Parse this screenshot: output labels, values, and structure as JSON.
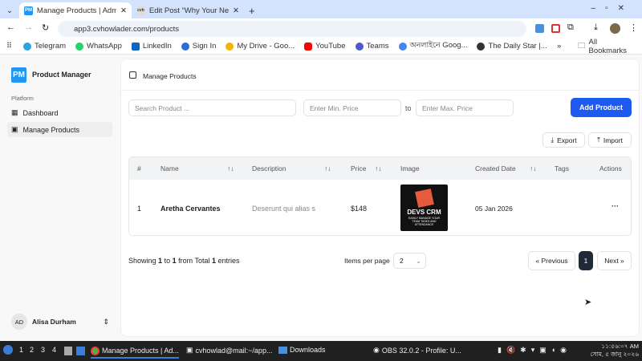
{
  "browser": {
    "tabs": [
      {
        "title": "Manage Products | Admin",
        "favicon": "PM"
      },
      {
        "title": "Edit Post “Why Your Next",
        "favicon": "cvh"
      }
    ],
    "url": "app3.cvhowlader.com/products",
    "bookmarks": [
      "Telegram",
      "WhatsApp",
      "LinkedIn",
      "Sign In",
      "My Drive - Goo...",
      "YouTube",
      "Teams",
      "অনলাইনে Goog...",
      "The Daily Star |..."
    ],
    "all_bookmarks": "All Bookmarks",
    "bookmark_colors": [
      "#2aa3e0",
      "#25d366",
      "#0a66c2",
      "#2b6cd8",
      "#f4b400",
      "#ff0000",
      "#5059c9",
      "#4285f4",
      "#333333"
    ]
  },
  "sidebar": {
    "logo": "PM",
    "app_name": "Product Manager",
    "section": "Platform",
    "items": [
      {
        "label": "Dashboard"
      },
      {
        "label": "Manage Products"
      }
    ],
    "user": {
      "initials": "AD",
      "name": "Alisa Durham"
    }
  },
  "main": {
    "breadcrumb": "Manage Products",
    "search_placeholder": "Search Product ...",
    "min_placeholder": "Enter Min. Price",
    "to": "to",
    "max_placeholder": "Enter Max. Price",
    "add_button": "Add Product",
    "export": "Export",
    "import": "Import",
    "columns": [
      "#",
      "Name",
      "Description",
      "Price",
      "Image",
      "Created Date",
      "Tags",
      "Actions"
    ],
    "rows": [
      {
        "num": "1",
        "name": "Aretha Cervantes",
        "description": "Deserunt qui alias s",
        "price": "$148",
        "image_title": "DEVS CRM",
        "image_sub": "EASILY MANAGE YOUR TEAM TASKS AND ATTENDANCE",
        "date": "05 Jan 2026",
        "tags": "",
        "actions": "···"
      }
    ],
    "showing": {
      "prefix": "Showing",
      "from": "1",
      "to_word": "to",
      "to": "1",
      "mid": "from Total",
      "total": "1",
      "suffix": "entries"
    },
    "items_per_page_label": "Items per page",
    "items_per_page": "2",
    "prev": "« Previous",
    "page": "1",
    "next": "Next »"
  },
  "taskbar": {
    "workspaces": [
      "1",
      "2",
      "3",
      "4"
    ],
    "apps": [
      "Manage Products | Ad...",
      "cvhowlad@mail:~/app...",
      "Downloads",
      "OBS 32.0.2 - Profile: U..."
    ],
    "time": "১১:৫৬:০৭ AM",
    "date": "সোম, ৫ জানু ২০২৬"
  }
}
